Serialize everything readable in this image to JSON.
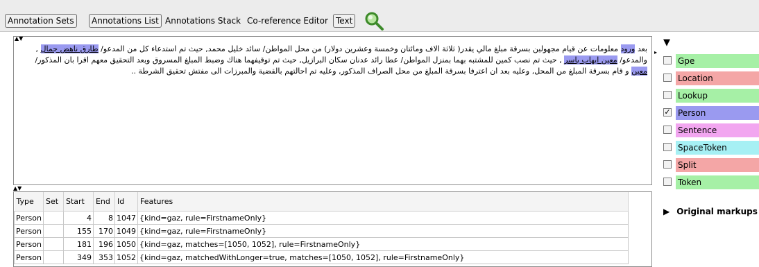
{
  "toolbar": {
    "annotation_sets": "Annotation Sets",
    "annotations_list": "Annotations List",
    "annotations_stack": "Annotations Stack",
    "coref_editor": "Co-reference Editor",
    "text": "Text"
  },
  "document": {
    "p1": "بعد",
    "h1": "ورود",
    "p2": "معلومات عن قيام مجهولين بسرقة مبلغ مالي يقدر( ثلاثة الاف ومائتان وخمسة وعشرين دولار) من محل المواطن/ سائد خليل محمد, حيث تم استدعاء كل من المدعو/",
    "h2": "طارق ناهض جمال",
    "p3": ", والمدعو/",
    "h3": "معين ايهاب ياسر",
    "p4": ", حيث تم نصب كمين للمشتبه بهما بمنزل المواطن/ عطا رائد عدنان سكان البرازيل, حيث تم توقيفهما هناك وضبط المبلغ المسروق وبعد التحقيق معهم اقرا بان المذكور/",
    "h4": "معين",
    "p5": "و قام بسرقة المبلغ من المحل, وعليه بعد ان اعترفا بسرقة المبلغ من محل الصراف المذكور, وعليه تم احالتهم بالقضية والمبرزات الى مفتش تحقيق الشرطة .."
  },
  "table": {
    "headers": [
      "Type",
      "Set",
      "Start",
      "End",
      "Id",
      "Features"
    ],
    "rows": [
      [
        "Person",
        "",
        "4",
        "8",
        "1047",
        "{kind=gaz, rule=FirstnameOnly}"
      ],
      [
        "Person",
        "",
        "155",
        "170",
        "1049",
        "{kind=gaz, rule=FirstnameOnly}"
      ],
      [
        "Person",
        "",
        "181",
        "196",
        "1050",
        "{kind=gaz, matches=[1050, 1052], rule=FirstnameOnly}"
      ],
      [
        "Person",
        "",
        "349",
        "353",
        "1052",
        "{kind=gaz, matchedWithLonger=true, matches=[1050, 1052], rule=FirstnameOnly}"
      ]
    ]
  },
  "annotation_sets": [
    {
      "label": "Gpe",
      "color": "#a6f0a6",
      "checked": false
    },
    {
      "label": "Location",
      "color": "#f4a6a6",
      "checked": false
    },
    {
      "label": "Lookup",
      "color": "#a6f0a6",
      "checked": false
    },
    {
      "label": "Person",
      "color": "#9a9af0",
      "checked": true
    },
    {
      "label": "Sentence",
      "color": "#f2a6f0",
      "checked": false
    },
    {
      "label": "SpaceToken",
      "color": "#a6f0f4",
      "checked": false
    },
    {
      "label": "Split",
      "color": "#f4a6a6",
      "checked": false
    },
    {
      "label": "Token",
      "color": "#a6f0a6",
      "checked": false
    }
  ],
  "original_markups": "Original markups"
}
